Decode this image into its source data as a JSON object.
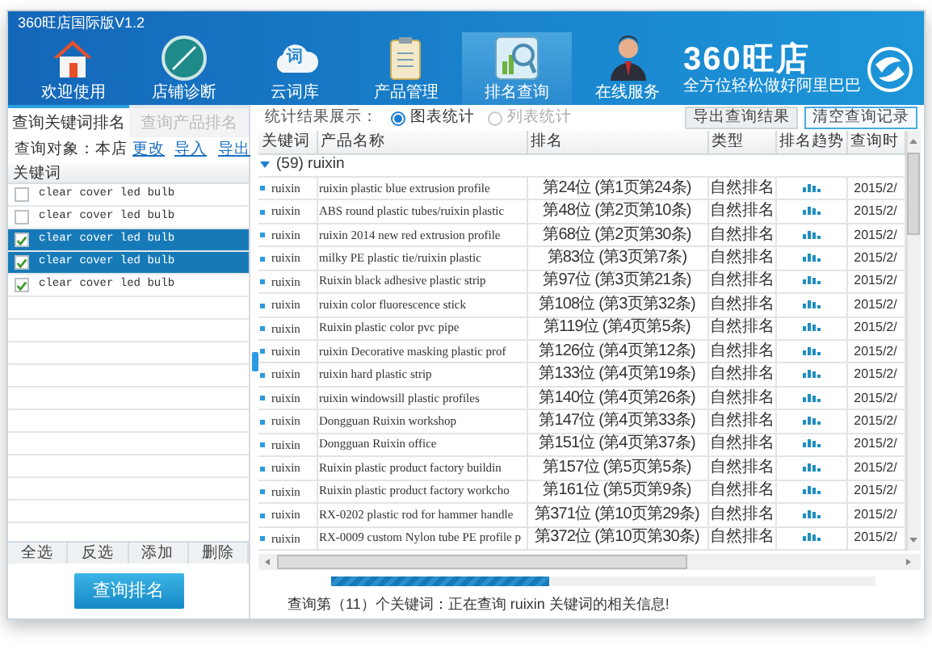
{
  "window": {
    "title": "360旺店国际版V1.2"
  },
  "nav": [
    {
      "label": "欢迎使用",
      "kind": "home",
      "selected": false
    },
    {
      "label": "店铺诊断",
      "kind": "gauge",
      "selected": false
    },
    {
      "label": "云词库",
      "kind": "cloud",
      "glyph": "词",
      "selected": false
    },
    {
      "label": "产品管理",
      "kind": "clipboard",
      "selected": false
    },
    {
      "label": "排名查询",
      "kind": "search-chart",
      "selected": true
    },
    {
      "label": "在线服务",
      "kind": "person",
      "selected": false
    }
  ],
  "logo": {
    "name": "360旺店",
    "slogan": "全方位轻松做好阿里巴巴"
  },
  "left_panel": {
    "tabs": [
      {
        "label": "查询关键词排名",
        "selected": true
      },
      {
        "label": "查询产品排名",
        "selected": false
      }
    ],
    "query_target": "查询对象：本店",
    "change_link": "更改",
    "import_link": "导入",
    "export_link": "导出",
    "column": "关键词",
    "keywords": [
      {
        "text": "clear cover led bulb",
        "checked": false,
        "selected": false
      },
      {
        "text": "clear cover led bulb",
        "checked": false,
        "selected": false
      },
      {
        "text": "clear cover led bulb",
        "checked": true,
        "selected": true
      },
      {
        "text": "clear cover led bulb",
        "checked": true,
        "selected": true
      },
      {
        "text": "clear cover led bulb",
        "checked": true,
        "selected": false
      }
    ],
    "actions": [
      "全选",
      "反选",
      "添加",
      "删除"
    ],
    "query_button": "查询排名"
  },
  "results": {
    "display_label": "统计结果展示：",
    "display_modes": [
      {
        "label": "图表统计",
        "selected": true
      },
      {
        "label": "列表统计",
        "selected": false
      }
    ],
    "buttons": [
      {
        "label": "导出查询结果",
        "focused": false
      },
      {
        "label": "清空查询记录",
        "focused": true
      }
    ],
    "columns": [
      "关键词",
      "产品名称",
      "排名",
      "类型",
      "排名趋势",
      "查询时"
    ],
    "group": {
      "label": "(59)  ruixin",
      "expanded": true
    },
    "rows": [
      {
        "keyword": "ruixin",
        "product": "ruixin plastic blue extrusion profile",
        "rank": "第24位 (第1页第24条)",
        "type": "自然排名",
        "date": "2015/2/"
      },
      {
        "keyword": "ruixin",
        "product": "ABS round plastic tubes/ruixin plastic",
        "rank": "第48位 (第2页第10条)",
        "type": "自然排名",
        "date": "2015/2/"
      },
      {
        "keyword": "ruixin",
        "product": "ruixin 2014 new red extrusion profile",
        "rank": "第68位 (第2页第30条)",
        "type": "自然排名",
        "date": "2015/2/"
      },
      {
        "keyword": "ruixin",
        "product": "milky PE plastic tie/ruixin plastic",
        "rank": "第83位 (第3页第7条)",
        "type": "自然排名",
        "date": "2015/2/"
      },
      {
        "keyword": "ruixin",
        "product": "Ruixin black adhesive plastic strip",
        "rank": "第97位 (第3页第21条)",
        "type": "自然排名",
        "date": "2015/2/"
      },
      {
        "keyword": "ruixin",
        "product": "ruixin color fluorescence stick",
        "rank": "第108位 (第3页第32条)",
        "type": "自然排名",
        "date": "2015/2/"
      },
      {
        "keyword": "ruixin",
        "product": "Ruixin plastic color pvc pipe",
        "rank": "第119位 (第4页第5条)",
        "type": "自然排名",
        "date": "2015/2/"
      },
      {
        "keyword": "ruixin",
        "product": "ruixin Decorative masking plastic prof",
        "rank": "第126位 (第4页第12条)",
        "type": "自然排名",
        "date": "2015/2/"
      },
      {
        "keyword": "ruixin",
        "product": "ruixin hard plastic strip",
        "rank": "第133位 (第4页第19条)",
        "type": "自然排名",
        "date": "2015/2/"
      },
      {
        "keyword": "ruixin",
        "product": "ruixin windowsill plastic profiles",
        "rank": "第140位 (第4页第26条)",
        "type": "自然排名",
        "date": "2015/2/"
      },
      {
        "keyword": "ruixin",
        "product": "Dongguan Ruixin workshop",
        "rank": "第147位 (第4页第33条)",
        "type": "自然排名",
        "date": "2015/2/"
      },
      {
        "keyword": "ruixin",
        "product": "Dongguan Ruixin office",
        "rank": "第151位 (第4页第37条)",
        "type": "自然排名",
        "date": "2015/2/"
      },
      {
        "keyword": "ruixin",
        "product": "Ruixin plastic product factory buildin",
        "rank": "第157位 (第5页第5条)",
        "type": "自然排名",
        "date": "2015/2/"
      },
      {
        "keyword": "ruixin",
        "product": "Ruixin plastic product factory workcho",
        "rank": "第161位 (第5页第9条)",
        "type": "自然排名",
        "date": "2015/2/"
      },
      {
        "keyword": "ruixin",
        "product": "RX-0202 plastic rod for hammer handle",
        "rank": "第371位 (第10页第29条)",
        "type": "自然排名",
        "date": "2015/2/"
      },
      {
        "keyword": "ruixin",
        "product": "RX-0009 custom Nylon tube PE profile p",
        "rank": "第372位 (第10页第30条)",
        "type": "自然排名",
        "date": "2015/2/"
      }
    ],
    "progress": {
      "level": 0.4
    },
    "status": "查询第（11）个关键词：正在查询 ruixin 关键词的相关信息!"
  }
}
